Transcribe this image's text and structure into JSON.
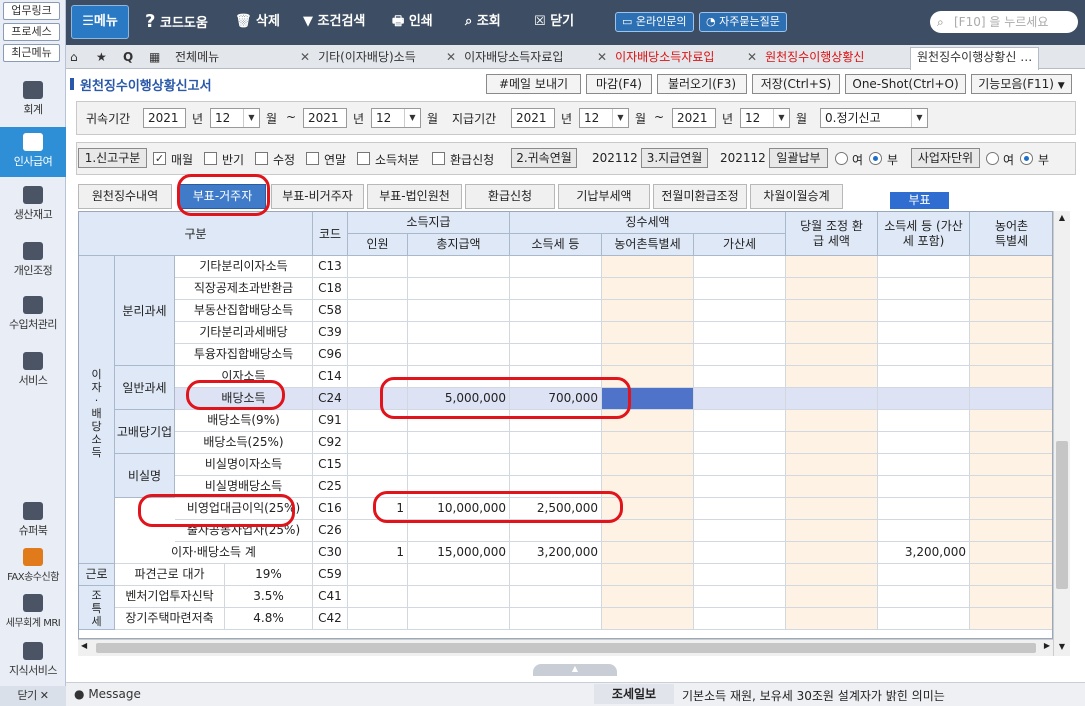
{
  "left_panel": {
    "top_buttons": [
      "업무링크",
      "프로세스",
      "최근메뉴"
    ],
    "nav": [
      {
        "label": "회계",
        "icon": "calculator-icon"
      },
      {
        "label": "인사급여",
        "icon": "person-icon"
      },
      {
        "label": "생산재고",
        "icon": "grid-icon"
      },
      {
        "label": "개인조정",
        "icon": "person-icon"
      },
      {
        "label": "수입처관리",
        "icon": "people-icon"
      },
      {
        "label": "서비스",
        "icon": "monitor-icon"
      },
      {
        "label": "슈퍼북",
        "icon": "book-icon"
      },
      {
        "label": "FAX송수신함",
        "icon": "fax-icon"
      },
      {
        "label": "세무회계 MRI",
        "icon": "chart-icon"
      },
      {
        "label": "지식서비스",
        "icon": "book-open-icon"
      }
    ],
    "close": "닫기"
  },
  "toolbar": {
    "menu": "메뉴",
    "help": "코드도움",
    "delete": "삭제",
    "filter": "조건검색",
    "print": "인쇄",
    "view": "조회",
    "close": "닫기",
    "online": "온라인문의",
    "faq": "자주묻는질문",
    "search_placeholder": "[F10] 을 누르세요"
  },
  "tabs": {
    "all_menu": "전체메뉴",
    "items": [
      {
        "label": "기타(이자배당)소득"
      },
      {
        "label": "이자배당소득자료입"
      },
      {
        "label": "이자배당소득자료입"
      },
      {
        "label": "원천징수이행상황신"
      },
      {
        "label": "원천징수이행상황신"
      }
    ]
  },
  "form": {
    "title": "원천징수이행상황신고서",
    "buttons": [
      "#메일 보내기",
      "마감(F4)",
      "불러오기(F3)",
      "저장(Ctrl+S)",
      "One-Shot(Ctrl+O)",
      "기능모음(F11)"
    ],
    "row1": {
      "attribution_label": "귀속기간",
      "attr_from_year": "2021",
      "year_unit": "년",
      "attr_from_month": "12",
      "month_unit": "월",
      "tilde": "~",
      "attr_to_year": "2021",
      "attr_to_month": "12",
      "payment_label": "지급기간",
      "pay_from_year": "2021",
      "pay_from_month": "12",
      "pay_to_year": "2021",
      "pay_to_month": "12",
      "report_type": "0.정기신고"
    },
    "row2": {
      "report_kind_btn": "1.신고구분",
      "monthly": "매월",
      "half": "반기",
      "amend": "수정",
      "annual": "연말",
      "disposal": "소득처분",
      "refund": "환급신청",
      "attr_ym_btn": "2.귀속연월",
      "attr_ym": "202112",
      "pay_ym_btn": "3.지급연월",
      "pay_ym": "202112",
      "lump_btn": "일괄납부",
      "yes": "여",
      "no": "부",
      "biz_unit_btn": "사업자단위"
    }
  },
  "subtabs": {
    "items": [
      "원천징수내역",
      "부표-거주자",
      "부표-비거주자",
      "부표-법인원천",
      "환급신청",
      "기납부세액",
      "전월미환급조정",
      "차월이월승계"
    ],
    "badge": "부표"
  },
  "grid": {
    "headers": {
      "category": "구분",
      "code": "코드",
      "income_pay": "소득지급",
      "persons": "인원",
      "total_pay": "총지급액",
      "withholding": "징수세액",
      "income_tax": "소득세 등",
      "rural_tax": "농어촌특별세",
      "penalty": "가산세",
      "month_refund": "당월 조정 환급 세액",
      "payable_tax": "소득세 등 (가산세 포함)",
      "payable_rural": "농어촌 특별세"
    },
    "group_interest_dividend": "이자·배당소득",
    "group_labor": "근로",
    "group_reduced": "조특세",
    "sub_separate": "분리과세",
    "sub_general": "일반과세",
    "sub_high": "고배당기업",
    "sub_nonreal": "비실명",
    "rows": [
      {
        "name": "기타분리이자소득",
        "code": "C13",
        "persons": "",
        "total": "",
        "tax": "",
        "payable": ""
      },
      {
        "name": "직장공제초과반환금",
        "code": "C18",
        "persons": "",
        "total": "",
        "tax": "",
        "payable": ""
      },
      {
        "name": "부동산집합배당소득",
        "code": "C58",
        "persons": "",
        "total": "",
        "tax": "",
        "payable": ""
      },
      {
        "name": "기타분리과세배당",
        "code": "C39",
        "persons": "",
        "total": "",
        "tax": "",
        "payable": ""
      },
      {
        "name": "투융자집합배당소득",
        "code": "C96",
        "persons": "",
        "total": "",
        "tax": "",
        "payable": ""
      },
      {
        "name": "이자소득",
        "code": "C14",
        "persons": "",
        "total": "",
        "tax": "",
        "payable": ""
      },
      {
        "name": "배당소득",
        "code": "C24",
        "persons": "",
        "total": "5,000,000",
        "tax": "700,000",
        "payable": ""
      },
      {
        "name": "배당소득(9%)",
        "code": "C91",
        "persons": "",
        "total": "",
        "tax": "",
        "payable": ""
      },
      {
        "name": "배당소득(25%)",
        "code": "C92",
        "persons": "",
        "total": "",
        "tax": "",
        "payable": ""
      },
      {
        "name": "비실명이자소득",
        "code": "C15",
        "persons": "",
        "total": "",
        "tax": "",
        "payable": ""
      },
      {
        "name": "비실명배당소득",
        "code": "C25",
        "persons": "",
        "total": "",
        "tax": "",
        "payable": ""
      },
      {
        "name": "비영업대금이익(25%)",
        "code": "C16",
        "persons": "1",
        "total": "10,000,000",
        "tax": "2,500,000",
        "payable": ""
      },
      {
        "name": "출자공동사업자(25%)",
        "code": "C26",
        "persons": "",
        "total": "",
        "tax": "",
        "payable": ""
      },
      {
        "name": "이자·배당소득 계",
        "code": "C30",
        "persons": "1",
        "total": "15,000,000",
        "tax": "3,200,000",
        "payable": "3,200,000"
      },
      {
        "name": "파견근로 대가",
        "rate": "19%",
        "code": "C59",
        "persons": "",
        "total": "",
        "tax": "",
        "payable": ""
      },
      {
        "name": "벤처기업투자신탁",
        "rate": "3.5%",
        "code": "C41",
        "persons": "",
        "total": "",
        "tax": "",
        "payable": ""
      },
      {
        "name": "장기주택마련저축",
        "rate": "4.8%",
        "code": "C42",
        "persons": "",
        "total": "",
        "tax": "",
        "payable": ""
      }
    ]
  },
  "bottom": {
    "message": "Message",
    "news_label": "조세일보",
    "news_text": "기본소득 재원, 보유세 30조원 설계자가 밝힌 의미는"
  },
  "colors": {
    "accent": "#2f8fd6",
    "toolbar": "#3d4d63",
    "highlight_oval": "#e0141a"
  }
}
